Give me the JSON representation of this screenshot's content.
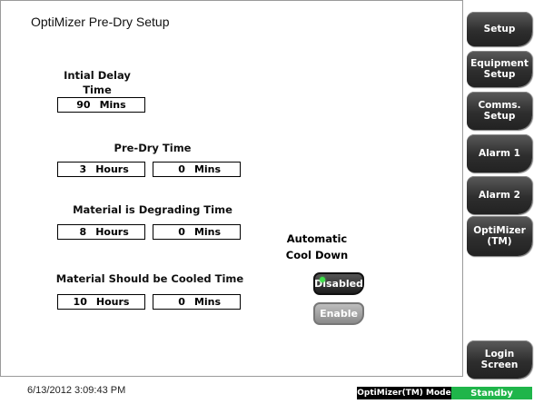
{
  "page": {
    "title": "OptiMizer Pre-Dry Setup"
  },
  "fields": {
    "initial_delay": {
      "label_line1": "Intial Delay",
      "label_line2": "Time",
      "value": "90",
      "unit": "Mins"
    },
    "pre_dry": {
      "label": "Pre-Dry Time",
      "hours_value": "3",
      "hours_unit": "Hours",
      "mins_value": "0",
      "mins_unit": "Mins"
    },
    "degrading": {
      "label": "Material is Degrading Time",
      "hours_value": "8",
      "hours_unit": "Hours",
      "mins_value": "0",
      "mins_unit": "Mins"
    },
    "cooled": {
      "label": "Material Should be Cooled Time",
      "hours_value": "10",
      "hours_unit": "Hours",
      "mins_value": "0",
      "mins_unit": "Mins"
    }
  },
  "auto_cool_down": {
    "label_line1": "Automatic",
    "label_line2": "Cool Down",
    "disabled_label": "Disabled",
    "enable_label": "Enable",
    "active": "Disabled",
    "led_color": "#3fe04a"
  },
  "sidebar": {
    "setup": "Setup",
    "equipment_setup_line1": "Equipment",
    "equipment_setup_line2": "Setup",
    "comms_setup_line1": "Comms.",
    "comms_setup_line2": "Setup",
    "alarm1": "Alarm 1",
    "alarm2": "Alarm 2",
    "optimizer_line1": "OptiMizer",
    "optimizer_line2": "(TM)",
    "login_line1": "Login",
    "login_line2": "Screen"
  },
  "status_bar": {
    "timestamp": "6/13/2012 3:09:43 PM",
    "mode_label": "OptiMizer(TM) Mode",
    "mode_status": "Standby",
    "status_color": "#1fb54a"
  }
}
